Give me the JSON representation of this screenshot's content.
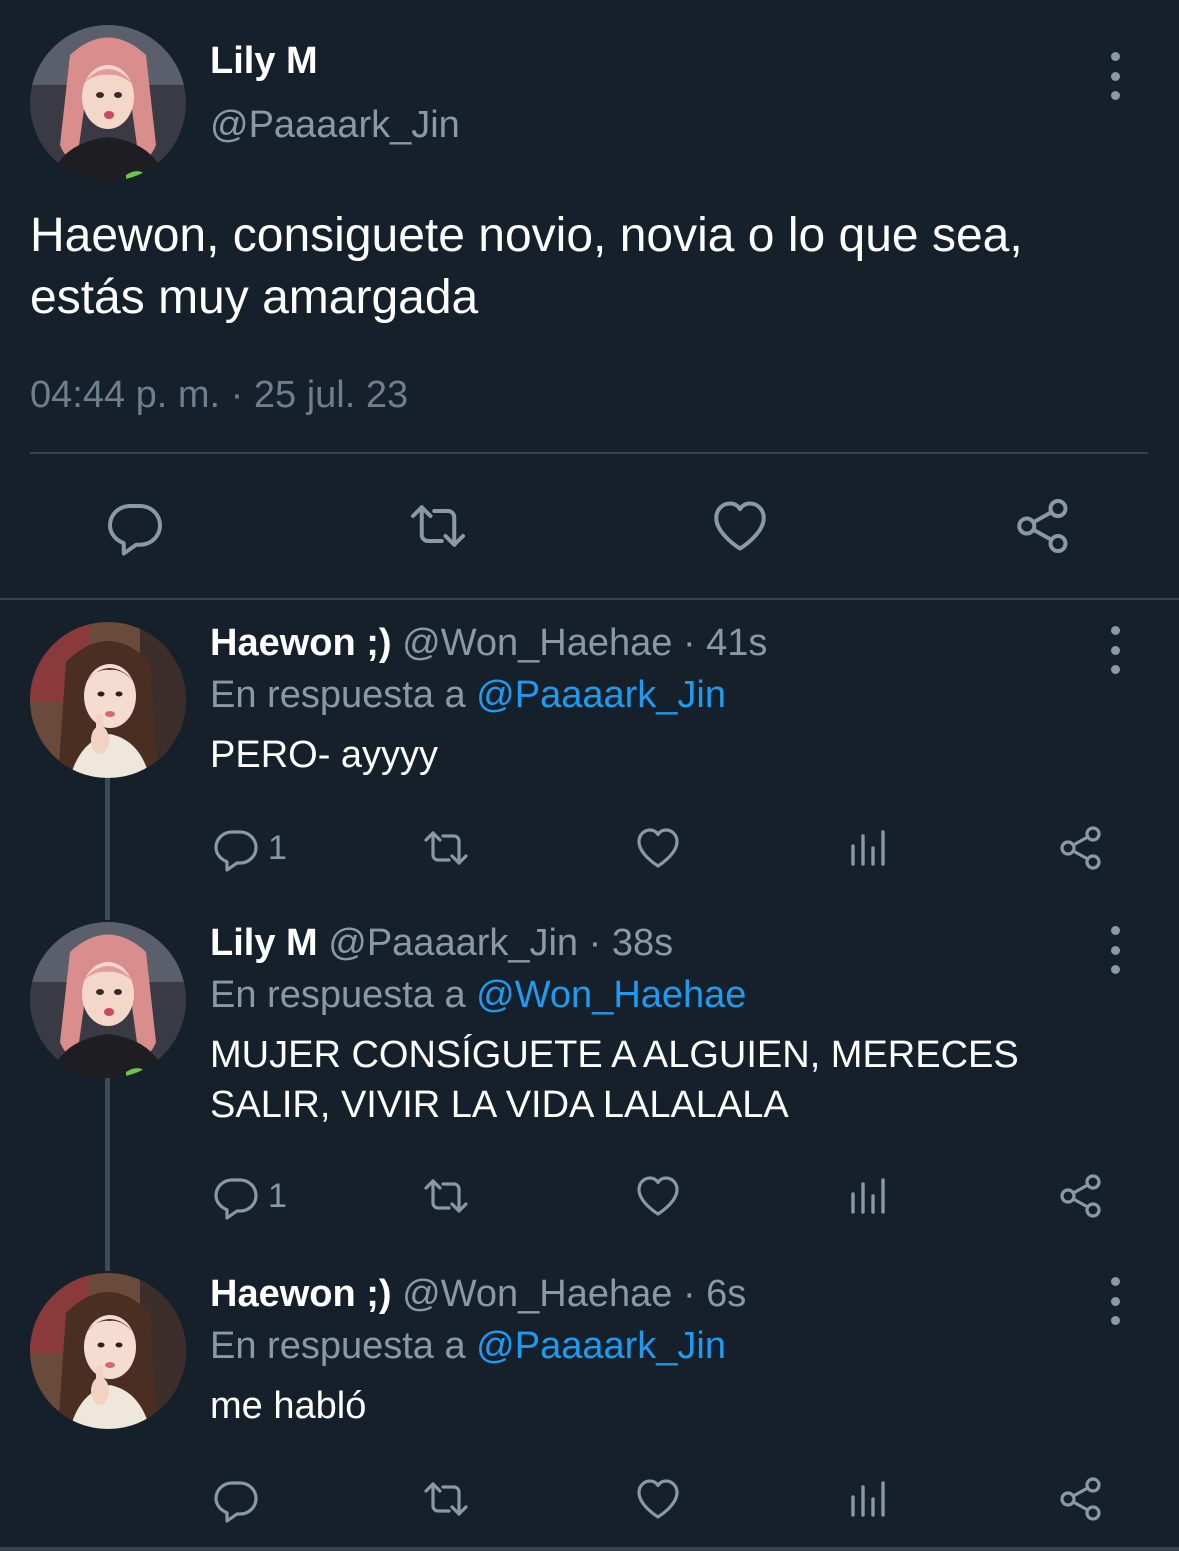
{
  "main_tweet": {
    "name": "Lily M",
    "handle": "@Paaaark_Jin",
    "text": "Haewon, consiguete novio, novia o lo que sea, estás muy amargada",
    "timestamp": "04:44 p. m. · 25 jul. 23",
    "actions": [
      "reply-icon",
      "retweet-icon",
      "like-icon",
      "share-icon"
    ]
  },
  "replies": [
    {
      "name": "Haewon ;)",
      "meta": "@Won_Haehae · 41s",
      "reply_prefix": "En respuesta a",
      "reply_to": "@Paaaark_Jin",
      "text": "PERO- ayyyy",
      "reply_count": "1"
    },
    {
      "name": "Lily M",
      "meta": "@Paaaark_Jin · 38s",
      "reply_prefix": "En respuesta a",
      "reply_to": "@Won_Haehae",
      "text": "MUJER CONSÍGUETE A ALGUIEN, MERECES SALIR, VIVIR LA VIDA LALALALA",
      "reply_count": "1"
    },
    {
      "name": "Haewon ;)",
      "meta": "@Won_Haehae · 6s",
      "reply_prefix": "En respuesta a",
      "reply_to": "@Paaaark_Jin",
      "text": "me habló",
      "reply_count": ""
    }
  ],
  "colors": {
    "background": "#15202b",
    "muted": "#8b98a5",
    "link": "#1d9bf0",
    "divider": "#38444d"
  }
}
